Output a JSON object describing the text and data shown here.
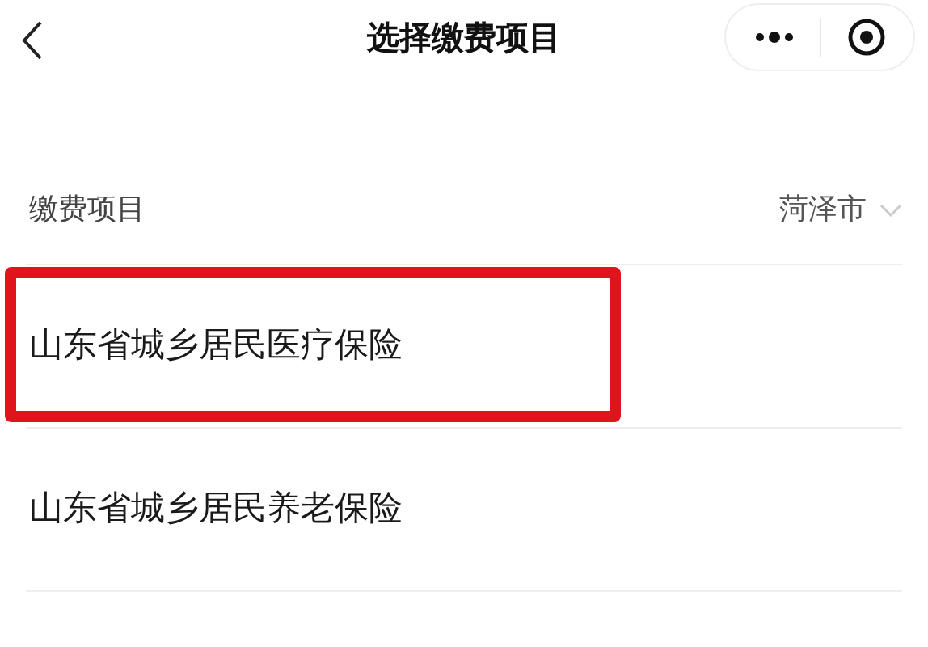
{
  "nav_bar": {
    "title": "选择缴费项目"
  },
  "filter": {
    "label": "缴费项目",
    "city": "菏泽市"
  },
  "items": [
    {
      "label": "山东省城乡居民医疗保险",
      "highlighted": true
    },
    {
      "label": "山东省城乡居民养老保险",
      "highlighted": false
    }
  ]
}
